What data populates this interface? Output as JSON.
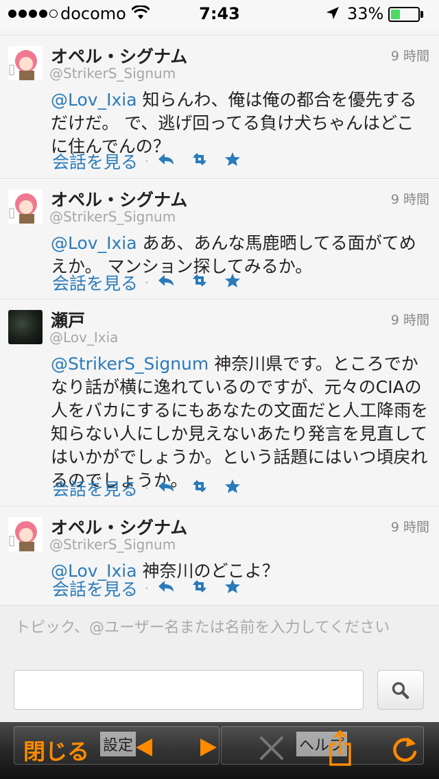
{
  "status_bar": {
    "carrier": "docomo",
    "time": "7:43",
    "battery_percent": "33%",
    "battery_level": 0.33,
    "signal_bars": 4,
    "battery_color": "#4cd964"
  },
  "tweets": [
    {
      "name": "オペル・シグナム",
      "handle": "@StrikerS_Signum",
      "time": "9 時間",
      "mention": "@Lov_Ixia",
      "text": " 知らんわ、俺は俺の都合を優先するだけだ。 で、逃げ回ってる負け犬ちゃんはどこに住んでんの？",
      "conversation_label": "会話を見る",
      "avatar": "anime-avatar"
    },
    {
      "name": "オペル・シグナム",
      "handle": "@StrikerS_Signum",
      "time": "9 時間",
      "mention": "@Lov_Ixia",
      "text": " ああ、あんな馬鹿晒してる面がてめえか。 マンション探してみるか。",
      "conversation_label": "会話を見る",
      "avatar": "anime-avatar"
    },
    {
      "name": "瀬戸",
      "handle": "@Lov_Ixia",
      "time": "9 時間",
      "mention": "@StrikerS_Signum",
      "text": " 神奈川県です。ところでかなり話が横に逸れているのですが、元々のCIAの人をバカにするにもあなたの文面だと人工降雨を知らない人にしか見えないあたり発言を見直してはいかがでしょうか。という話題にはいつ頃戻れるのでしょうか。",
      "conversation_label": "会話を見る",
      "avatar": "dark-avatar"
    },
    {
      "name": "オペル・シグナム",
      "handle": "@StrikerS_Signum",
      "time": "9 時間",
      "mention": "@Lov_Ixia",
      "text": " 神奈川のどこよ？",
      "conversation_label": "会話を見る",
      "avatar": "anime-avatar"
    }
  ],
  "search": {
    "hint": "トピック、@ユーザー名または名前を入力してください",
    "input_value": "",
    "button_icon": "search-icon"
  },
  "toolbar": {
    "close_label": "閉じる",
    "settings_label": "設定",
    "help_label": "ヘルプ",
    "accent_color": "#ff8a00"
  },
  "colors": {
    "link": "#2b7bb9",
    "background": "#f5f5f5"
  }
}
